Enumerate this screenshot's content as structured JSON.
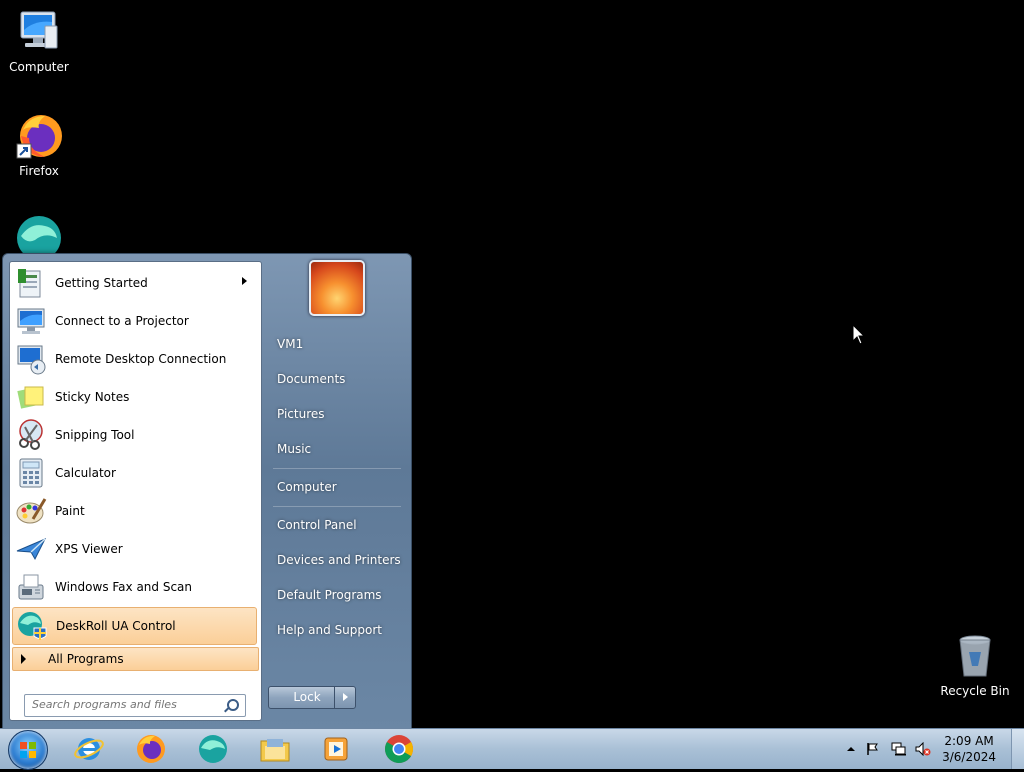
{
  "desktop": {
    "icons": [
      {
        "label": "Computer"
      },
      {
        "label": "Firefox"
      },
      {
        "label": ""
      },
      {
        "label": "Recycle Bin"
      }
    ]
  },
  "start_menu": {
    "programs": [
      {
        "label": "Getting Started",
        "icon": "getting-started-icon"
      },
      {
        "label": "Connect to a Projector",
        "icon": "projector-icon"
      },
      {
        "label": "Remote Desktop Connection",
        "icon": "remote-desktop-icon"
      },
      {
        "label": "Sticky Notes",
        "icon": "sticky-notes-icon"
      },
      {
        "label": "Snipping Tool",
        "icon": "scissors-icon"
      },
      {
        "label": "Calculator",
        "icon": "calculator-icon"
      },
      {
        "label": "Paint",
        "icon": "paint-palette-icon"
      },
      {
        "label": "XPS Viewer",
        "icon": "xps-viewer-icon"
      },
      {
        "label": "Windows Fax and Scan",
        "icon": "fax-icon"
      },
      {
        "label": "DeskRoll UA Control",
        "icon": "deskroll-icon"
      }
    ],
    "all_programs": "All Programs",
    "search_placeholder": "Search programs and files",
    "right_items": [
      {
        "label": "VM1"
      },
      {
        "label": "Documents"
      },
      {
        "label": "Pictures"
      },
      {
        "label": "Music"
      },
      {
        "label": "Computer"
      },
      {
        "label": "Control Panel"
      },
      {
        "label": "Devices and Printers"
      },
      {
        "label": "Default Programs"
      },
      {
        "label": "Help and Support"
      }
    ],
    "lock_label": "Lock"
  },
  "taskbar": {
    "pinned": [
      "internet-explorer-icon",
      "firefox-icon",
      "deskroll-icon",
      "file-explorer-icon",
      "media-player-icon",
      "chrome-icon"
    ],
    "time": "2:09 AM",
    "date": "3/6/2024"
  }
}
